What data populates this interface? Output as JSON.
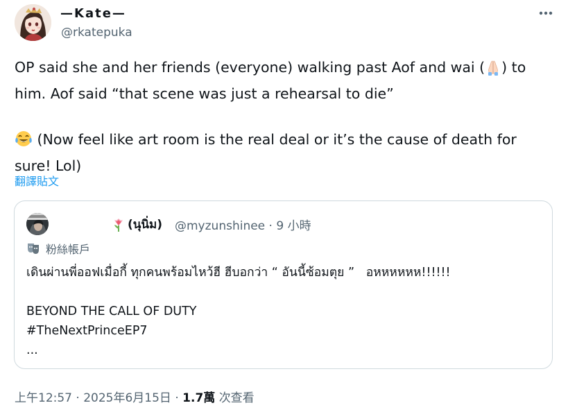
{
  "author": {
    "display_name": "—Kate—",
    "handle": "@rkatepuka"
  },
  "tweet": {
    "text_before_emoji": "OP said she and her friends (everyone) walking past Aof and wai (",
    "emoji_praying": "praying-hands-icon",
    "text_after_emoji": ") to\nhim. Aof said “that scene was just a rehearsal to die”\n\n",
    "emoji_laughing": "tears-of-joy-icon",
    "text_end": " (Now feel like art room is the real deal or it’s the cause of death for\nsure! Lol)"
  },
  "translate_link": "翻譯貼文",
  "quoted": {
    "display_name": "(นุนิ่ม)",
    "handle": "@myzunshinee",
    "time": "9 小時",
    "badge": "粉絲帳戶",
    "text": "เดินผ่านพี่ออฟเมื่อกี้ ทุกคนพร้อมไหว้ฮี ฮีบอกว่า “ อันนี้ซ้อมตุย ”   อหหหหหห!!!!!!\n\nBEYOND THE CALL OF DUTY\n#TheNextPrinceEP7\n..."
  },
  "footer": {
    "time": "上午12:57",
    "date": "2025年6月15日",
    "views_count": "1.7萬",
    "views_label": "次查看"
  },
  "colors": {
    "text": "#0f1419",
    "secondary": "#536471",
    "link": "#1d9bf0",
    "border": "#cfd9de"
  }
}
